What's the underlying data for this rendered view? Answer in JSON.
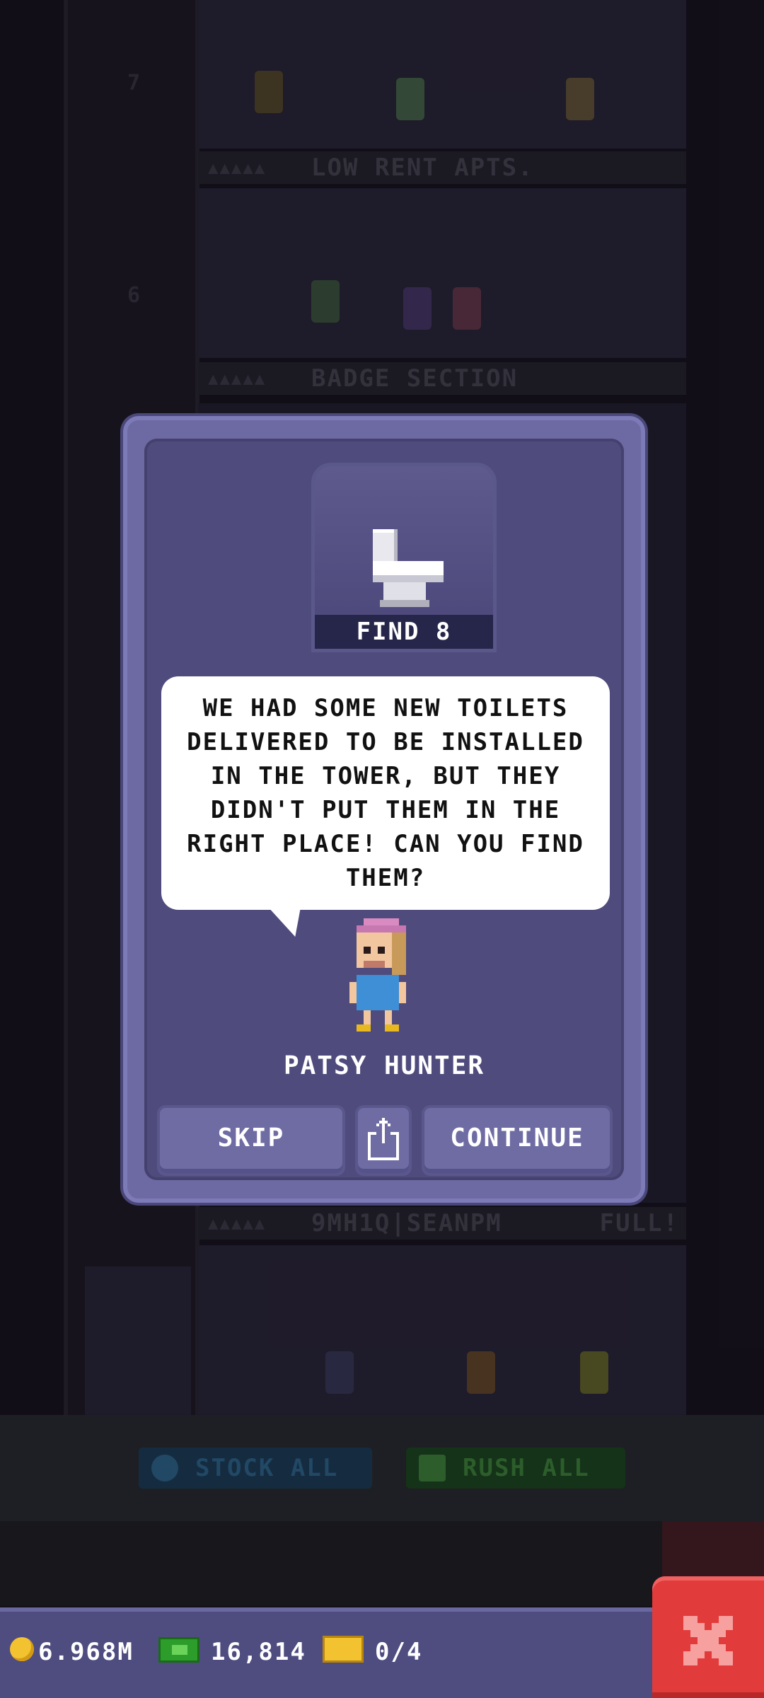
{
  "tower": {
    "floor_top_label": "LOW RENT APTS.",
    "floor_mid_label": "BADGE SECTION",
    "floor_bottom_label": "9MH1Q|SEANPM",
    "floor_bottom_status": "FULL!",
    "shaft_numbers": [
      "7",
      "6"
    ],
    "floor_label_dots": "▲▲▲▲▲"
  },
  "background_actions": {
    "stock_all_label": "STOCK ALL",
    "rush_all_label": "RUSH ALL"
  },
  "mission": {
    "badge": "FIND 8",
    "icon": "toilet-icon",
    "message": "WE HAD SOME NEW TOILETS DELIVERED TO BE INSTALLED IN THE TOWER, BUT THEY DIDN'T PUT THEM IN THE RIGHT PLACE! CAN YOU FIND THEM?",
    "npc_name": "PATSY HUNTER"
  },
  "dialog_buttons": {
    "skip_label": "SKIP",
    "share_icon": "share-icon",
    "continue_label": "CONTINUE"
  },
  "status_bar": {
    "coins": "6.968M",
    "bux": "16,814",
    "tickets": "0/4",
    "close_icon": "close-icon"
  },
  "colors": {
    "dialog_outer": "#6d6aa3",
    "dialog_inner": "#4f4b7d",
    "close_button": "#e23b3b",
    "status_bar": "#4f4d80"
  }
}
